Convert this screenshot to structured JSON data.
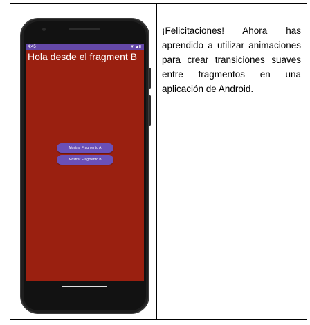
{
  "phone": {
    "status_bar": {
      "time": "4:45",
      "icons": "▼◢▮"
    },
    "app_title": "Hola desde el fragment B",
    "buttons": [
      {
        "label": "Mostrar Fragmento A"
      },
      {
        "label": "Mostrar Fragmento B"
      }
    ],
    "colors": {
      "screen_bg": "#9a2010",
      "status_bar": "#6448a8",
      "button": "#6a50b8"
    }
  },
  "description": "¡Felicitaciones! Ahora has aprendido a utilizar animaciones para crear transiciones suaves entre fragmentos en una aplicación de Android."
}
